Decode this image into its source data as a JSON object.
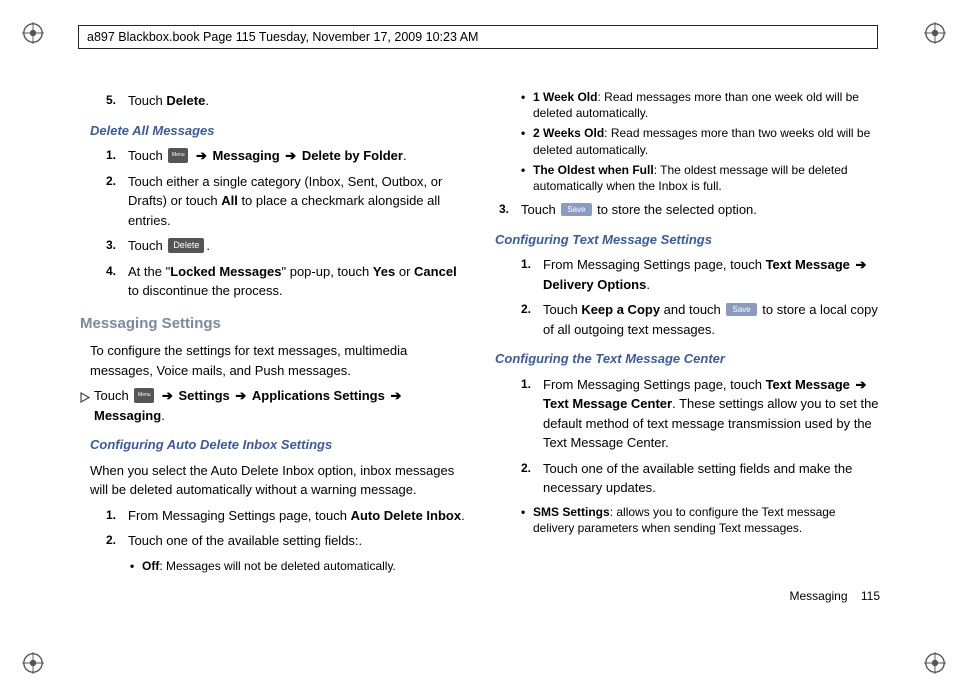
{
  "header": "a897 Blackbox.book  Page 115  Tuesday, November 17, 2009  10:23 AM",
  "left": {
    "s5_num": "5.",
    "s5_body": "Touch ",
    "s5_bold": "Delete",
    "s5_after": ".",
    "h_del_all": "Delete All Messages",
    "s1_num": "1.",
    "s1_a": "Touch ",
    "s1_b": "Messaging",
    "s1_c": "Delete by Folder",
    "s1_after": ".",
    "s2_num": "2.",
    "s2_a": "Touch either a single category (Inbox, Sent, Outbox, or Drafts) or touch ",
    "s2_b": "All",
    "s2_c": " to place a checkmark alongside all entries.",
    "s3_num": "3.",
    "s3_a": "Touch ",
    "delete_label": "Delete",
    "s3_after": ".",
    "s4_num": "4.",
    "s4_a": "At the \"",
    "s4_b": "Locked Messages",
    "s4_c": "\" pop-up, touch ",
    "s4_d": "Yes",
    "s4_e": " or ",
    "s4_f": "Cancel",
    "s4_g": " to discontinue the process.",
    "h_msg_set": "Messaging Settings",
    "p_msg": "To configure the settings for text messages, multimedia messages, Voice mails, and Push messages.",
    "tri_a": "Touch ",
    "tri_b": "Settings",
    "tri_c": "Applications Settings",
    "tri_d": "Messaging",
    "tri_after": ".",
    "h_auto": "Configuring Auto Delete Inbox Settings",
    "p_auto": "When you select the Auto Delete Inbox option, inbox messages will be deleted automatically without a warning message.",
    "a1_num": "1.",
    "a1_a": "From Messaging Settings page, touch ",
    "a1_b": "Auto Delete Inbox",
    "a1_after": ".",
    "a2_num": "2.",
    "a2_body": "Touch one of the available setting fields:.",
    "b_off_t": "Off",
    "b_off_d": ": Messages will not be deleted automatically."
  },
  "right": {
    "b1_t": "1 Week Old",
    "b1_d": ": Read messages more than one week old will be deleted automatically.",
    "b2_t": "2 Weeks Old",
    "b2_d": ": Read messages more than two weeks old will be deleted automatically.",
    "b3_t": "The Oldest when Full",
    "b3_d": ": The oldest message will be deleted automatically when the Inbox is full.",
    "s3_num": "3.",
    "s3_a": "Touch ",
    "save_label": "Save",
    "s3_b": " to store the selected option.",
    "h_txt": "Configuring Text Message Settings",
    "t1_num": "1.",
    "t1_a": "From Messaging Settings page, touch ",
    "t1_b": "Text Message",
    "t1_c": "Delivery Options",
    "t1_after": ".",
    "t2_num": "2.",
    "t2_a": "Touch ",
    "t2_b": "Keep a Copy",
    "t2_c": " and touch ",
    "t2_d": " to store a local copy of all outgoing text messages.",
    "h_ctr": "Configuring the Text Message Center",
    "c1_num": "1.",
    "c1_a": "From Messaging Settings page, touch ",
    "c1_b": "Text Message",
    "c1_c": "Text Message Center",
    "c1_d": ". These settings allow you to set the default method of text message transmission used by the Text Message Center.",
    "c2_num": "2.",
    "c2_body": "Touch one of the available setting fields and make the necessary updates.",
    "bs_t": "SMS Settings",
    "bs_d": ": allows you to configure the Text message delivery parameters when sending Text messages."
  },
  "footer": {
    "cat": "Messaging",
    "num": "115"
  },
  "arrow": "➔",
  "menu_txt": "Menu"
}
